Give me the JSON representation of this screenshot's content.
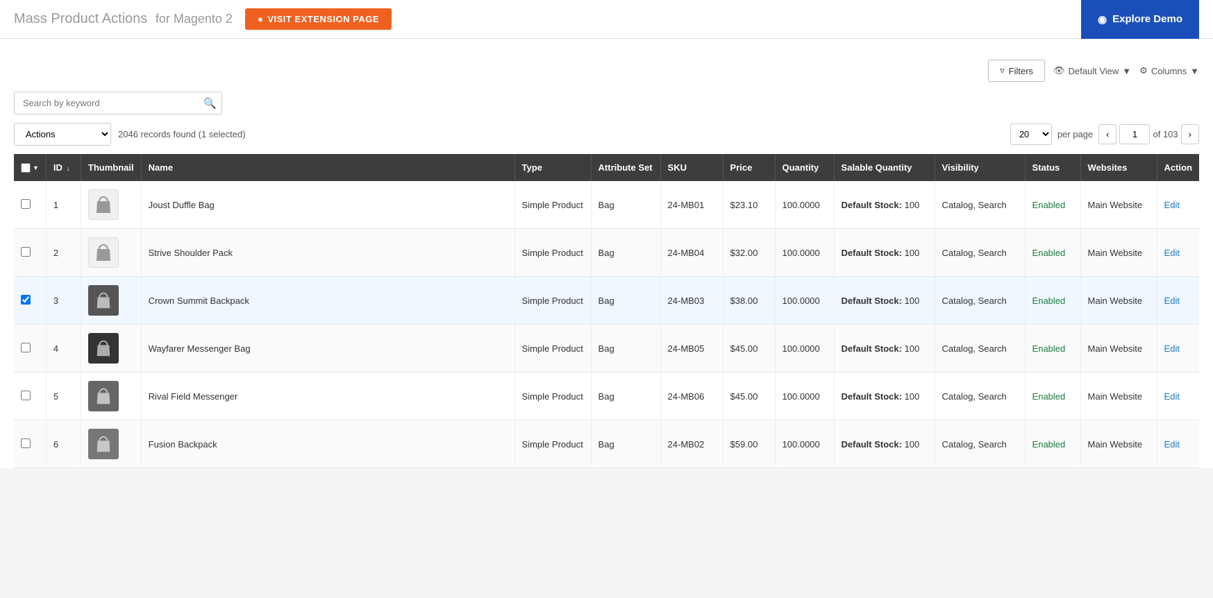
{
  "header": {
    "title": "Mass Product Actions",
    "subtitle": "for Magento 2",
    "visit_btn": "VISIT EXTENSION PAGE",
    "explore_btn": "Explore Demo"
  },
  "toolbar": {
    "filters_label": "Filters",
    "default_view_label": "Default View",
    "columns_label": "Columns",
    "search_placeholder": "Search by keyword",
    "actions_label": "Actions",
    "records_count": "2046 records found (1 selected)",
    "per_page": "20",
    "per_page_label": "per page",
    "current_page": "1",
    "total_pages": "103"
  },
  "table": {
    "columns": [
      "",
      "ID",
      "Thumbnail",
      "Name",
      "Type",
      "Attribute Set",
      "SKU",
      "Price",
      "Quantity",
      "Salable Quantity",
      "Visibility",
      "Status",
      "Websites",
      "Action"
    ],
    "rows": [
      {
        "id": "1",
        "name": "Joust Duffle Bag",
        "type": "Simple Product",
        "attr_set": "Bag",
        "sku": "24-MB01",
        "price": "$23.10",
        "quantity": "100.0000",
        "salable": "Default Stock: 100",
        "visibility": "Catalog, Search",
        "status": "Enabled",
        "websites": "Main Website",
        "checked": false,
        "has_image": false
      },
      {
        "id": "2",
        "name": "Strive Shoulder Pack",
        "type": "Simple Product",
        "attr_set": "Bag",
        "sku": "24-MB04",
        "price": "$32.00",
        "quantity": "100.0000",
        "salable": "Default Stock: 100",
        "visibility": "Catalog, Search",
        "status": "Enabled",
        "websites": "Main Website",
        "checked": false,
        "has_image": false
      },
      {
        "id": "3",
        "name": "Crown Summit Backpack",
        "type": "Simple Product",
        "attr_set": "Bag",
        "sku": "24-MB03",
        "price": "$38.00",
        "quantity": "100.0000",
        "salable": "Default Stock: 100",
        "visibility": "Catalog, Search",
        "status": "Enabled",
        "websites": "Main Website",
        "checked": true,
        "has_image": true,
        "image_color": "#555"
      },
      {
        "id": "4",
        "name": "Wayfarer Messenger Bag",
        "type": "Simple Product",
        "attr_set": "Bag",
        "sku": "24-MB05",
        "price": "$45.00",
        "quantity": "100.0000",
        "salable": "Default Stock: 100",
        "visibility": "Catalog, Search",
        "status": "Enabled",
        "websites": "Main Website",
        "checked": false,
        "has_image": true,
        "image_color": "#333"
      },
      {
        "id": "5",
        "name": "Rival Field Messenger",
        "type": "Simple Product",
        "attr_set": "Bag",
        "sku": "24-MB06",
        "price": "$45.00",
        "quantity": "100.0000",
        "salable": "Default Stock: 100",
        "visibility": "Catalog, Search",
        "status": "Enabled",
        "websites": "Main Website",
        "checked": false,
        "has_image": true,
        "image_color": "#666"
      },
      {
        "id": "6",
        "name": "Fusion Backpack",
        "type": "Simple Product",
        "attr_set": "Bag",
        "sku": "24-MB02",
        "price": "$59.00",
        "quantity": "100.0000",
        "salable": "Default Stock: 100",
        "visibility": "Catalog, Search",
        "status": "Enabled",
        "websites": "Main Website",
        "checked": false,
        "has_image": true,
        "image_color": "#777"
      }
    ]
  }
}
